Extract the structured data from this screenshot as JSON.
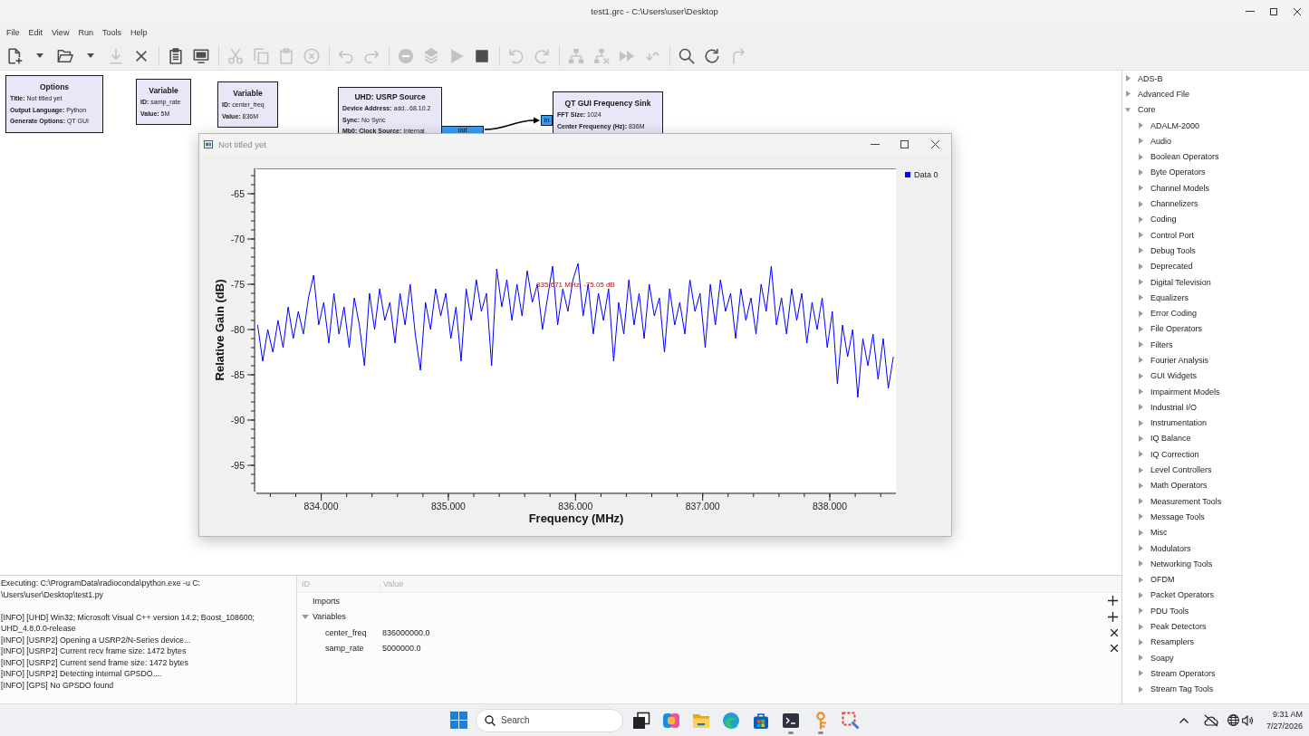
{
  "window": {
    "title": "test1.grc - C:\\Users\\user\\Desktop"
  },
  "menu": [
    "File",
    "Edit",
    "View",
    "Run",
    "Tools",
    "Help"
  ],
  "toolbar": {
    "groups": [
      [
        {
          "disabled": false
        },
        {
          "disabled": false
        },
        {
          "disabled": false
        },
        {
          "disabled": false
        },
        {
          "disabled": true
        },
        {
          "disabled": false
        }
      ],
      [
        {
          "disabled": false
        },
        {
          "disabled": false
        }
      ],
      [
        {
          "disabled": true
        },
        {
          "disabled": true
        },
        {
          "disabled": true
        },
        {
          "disabled": true
        }
      ],
      [
        {
          "disabled": true
        },
        {
          "disabled": true
        }
      ],
      [
        {
          "disabled": true
        },
        {
          "disabled": true
        },
        {
          "disabled": true
        },
        {
          "disabled": false
        }
      ],
      [
        {
          "disabled": true
        },
        {
          "disabled": true
        }
      ],
      [
        {
          "disabled": true
        },
        {
          "disabled": true
        },
        {
          "disabled": true
        },
        {
          "disabled": true
        }
      ],
      [
        {
          "disabled": false
        },
        {
          "disabled": false
        },
        {
          "disabled": true
        }
      ]
    ]
  },
  "canvas": {
    "blocks": [
      {
        "title": "Options",
        "params": [
          {
            "key": "Title:",
            "value": "Not titled yet"
          },
          {
            "key": "Output Language:",
            "value": "Python"
          },
          {
            "key": "Generate Options:",
            "value": "QT GUI"
          }
        ]
      },
      {
        "title": "Variable",
        "params": [
          {
            "key": "ID:",
            "value": "samp_rate"
          },
          {
            "key": "Value:",
            "value": "5M"
          }
        ]
      },
      {
        "title": "Variable",
        "params": [
          {
            "key": "ID:",
            "value": "center_freq"
          },
          {
            "key": "Value:",
            "value": "836M"
          }
        ]
      },
      {
        "title": "UHD: USRP Source",
        "params": [
          {
            "key": "Device Address:",
            "value": "add...68.10.2"
          },
          {
            "key": "Sync:",
            "value": "No Sync"
          },
          {
            "key": "Mb0: Clock Source:",
            "value": "Internal"
          }
        ],
        "ports": [
          {
            "kind": "out",
            "label": "out"
          }
        ]
      },
      {
        "title": "QT GUI Frequency Sink",
        "params": [
          {
            "key": "FFT Size:",
            "value": "1024"
          },
          {
            "key": "Center Frequency (Hz):",
            "value": "836M"
          }
        ],
        "ports": [
          {
            "kind": "in",
            "label": "in"
          }
        ]
      }
    ]
  },
  "plot_window": {
    "title": "Not titled yet",
    "chart_data": {
      "type": "line",
      "xlabel": "Frequency (MHz)",
      "ylabel": "Relative Gain (dB)",
      "x": [
        833.5,
        833.54,
        833.58,
        833.62,
        833.66,
        833.7,
        833.74,
        833.78,
        833.82,
        833.86,
        833.9,
        833.94,
        833.98,
        834.02,
        834.06,
        834.1,
        834.14,
        834.18,
        834.22,
        834.26,
        834.3,
        834.34,
        834.38,
        834.42,
        834.46,
        834.5,
        834.54,
        834.58,
        834.62,
        834.66,
        834.7,
        834.74,
        834.78,
        834.82,
        834.86,
        834.9,
        834.94,
        834.98,
        835.02,
        835.06,
        835.1,
        835.14,
        835.18,
        835.22,
        835.26,
        835.3,
        835.34,
        835.38,
        835.42,
        835.46,
        835.5,
        835.54,
        835.58,
        835.62,
        835.66,
        835.7,
        835.74,
        835.78,
        835.82,
        835.86,
        835.9,
        835.94,
        835.98,
        836.02,
        836.06,
        836.1,
        836.14,
        836.18,
        836.22,
        836.26,
        836.3,
        836.34,
        836.38,
        836.42,
        836.46,
        836.5,
        836.54,
        836.58,
        836.62,
        836.66,
        836.7,
        836.74,
        836.78,
        836.82,
        836.86,
        836.9,
        836.94,
        836.98,
        837.02,
        837.06,
        837.1,
        837.14,
        837.18,
        837.22,
        837.26,
        837.3,
        837.34,
        837.38,
        837.42,
        837.46,
        837.5,
        837.54,
        837.58,
        837.62,
        837.66,
        837.7,
        837.74,
        837.78,
        837.82,
        837.86,
        837.9,
        837.94,
        837.98,
        838.02,
        838.06,
        838.1,
        838.14,
        838.18,
        838.22,
        838.26,
        838.3,
        838.34,
        838.38,
        838.42,
        838.46,
        838.5
      ],
      "series": [
        {
          "name": "Data 0",
          "color": "#0000ff",
          "values": [
            -79.5,
            -83.5,
            -80,
            -82.5,
            -79,
            -82,
            -77.5,
            -81,
            -78,
            -80.5,
            -76.5,
            -74,
            -79.5,
            -77,
            -81.5,
            -76,
            -80.5,
            -77.5,
            -82,
            -76.5,
            -79.5,
            -84,
            -76,
            -80,
            -75.5,
            -79,
            -77,
            -81.5,
            -76,
            -79.5,
            -75,
            -80.5,
            -84.5,
            -77,
            -80,
            -75.5,
            -78.5,
            -76,
            -81,
            -77.5,
            -83.5,
            -75.5,
            -79,
            -74.5,
            -78,
            -76,
            -84,
            -73.3,
            -77.5,
            -74.5,
            -79,
            -75,
            -78.5,
            -73.5,
            -77,
            -75,
            -80,
            -76.5,
            -73,
            -79.5,
            -75.5,
            -78,
            -74.5,
            -72.7,
            -78.5,
            -75,
            -80.5,
            -76,
            -79,
            -75.5,
            -83.5,
            -77,
            -80.5,
            -74.5,
            -79.5,
            -76,
            -81,
            -75,
            -78.5,
            -76.5,
            -82.5,
            -75.5,
            -79.5,
            -77,
            -80.5,
            -74.5,
            -78,
            -76,
            -82,
            -75,
            -79.5,
            -74.5,
            -78,
            -76,
            -81,
            -75.5,
            -79,
            -76.5,
            -80.5,
            -75,
            -78,
            -73,
            -79.5,
            -76.5,
            -80.5,
            -75.5,
            -79,
            -76,
            -81.5,
            -77,
            -80,
            -76.5,
            -82,
            -78,
            -86,
            -79.5,
            -83,
            -80,
            -87.5,
            -81,
            -84,
            -80.5,
            -85.5,
            -81,
            -86.5,
            -83
          ]
        }
      ],
      "xlim": [
        833.49,
        838.52
      ],
      "ylim": [
        -97.9,
        -62.2
      ],
      "xticks": [
        {
          "value": 834,
          "label": "834.000"
        },
        {
          "value": 835,
          "label": "835.000"
        },
        {
          "value": 836,
          "label": "836.000"
        },
        {
          "value": 837,
          "label": "837.000"
        },
        {
          "value": 838,
          "label": "838.000"
        }
      ],
      "yticks": [
        -95,
        -90,
        -85,
        -80,
        -75,
        -70,
        -65
      ],
      "annotations": [
        {
          "text": "835.671 MHz, -75.05 dB",
          "x": 835.671,
          "y": -75.05
        }
      ]
    }
  },
  "console": {
    "entries": [
      {
        "kind": "command",
        "lines": [
          "Executing: C:\\ProgramData\\radioconda\\python.exe -u C:",
          "\\Users\\user\\Desktop\\test1.py"
        ]
      },
      {
        "kind": "log",
        "lines": [
          "[INFO] [UHD] Win32; Microsoft Visual C++ version 14.2; Boost_108600;",
          "UHD_4.8.0.0-release"
        ]
      },
      {
        "kind": "log",
        "lines": [
          "[INFO] [USRP2] Opening a USRP2/N-Series device..."
        ]
      },
      {
        "kind": "log",
        "lines": [
          "[INFO] [USRP2] Current recv frame size: 1472 bytes"
        ]
      },
      {
        "kind": "log",
        "lines": [
          "[INFO] [USRP2] Current send frame size: 1472 bytes"
        ]
      },
      {
        "kind": "log",
        "lines": [
          "[INFO] [USRP2] Detecting internal GPSDO...."
        ]
      },
      {
        "kind": "log",
        "lines": [
          "[INFO] [GPS] No GPSDO found"
        ]
      }
    ]
  },
  "variables": {
    "columns": [
      "ID",
      "Value"
    ],
    "rows": [
      {
        "kind": "group",
        "label": "Imports"
      },
      {
        "kind": "group",
        "label": "Variables",
        "expanded": true,
        "children": [
          {
            "kind": "variable",
            "label": "center_freq",
            "value": "836000000.0"
          },
          {
            "kind": "variable",
            "label": "samp_rate",
            "value": "5000000.0"
          }
        ]
      }
    ]
  },
  "block_tree": [
    {
      "label": "ADS-B",
      "expanded": false
    },
    {
      "label": "Advanced File",
      "expanded": false
    },
    {
      "label": "Core",
      "expanded": true,
      "children": [
        {
          "label": "ADALM-2000",
          "expanded": false
        },
        {
          "label": "Audio",
          "expanded": false
        },
        {
          "label": "Boolean Operators",
          "expanded": false
        },
        {
          "label": "Byte Operators",
          "expanded": false
        },
        {
          "label": "Channel Models",
          "expanded": false
        },
        {
          "label": "Channelizers",
          "expanded": false
        },
        {
          "label": "Coding",
          "expanded": false
        },
        {
          "label": "Control Port",
          "expanded": false
        },
        {
          "label": "Debug Tools",
          "expanded": false
        },
        {
          "label": "Deprecated",
          "expanded": false
        },
        {
          "label": "Digital Television",
          "expanded": false
        },
        {
          "label": "Equalizers",
          "expanded": false
        },
        {
          "label": "Error Coding",
          "expanded": false
        },
        {
          "label": "File Operators",
          "expanded": false
        },
        {
          "label": "Filters",
          "expanded": false
        },
        {
          "label": "Fourier Analysis",
          "expanded": false
        },
        {
          "label": "GUI Widgets",
          "expanded": false
        },
        {
          "label": "Impairment Models",
          "expanded": false
        },
        {
          "label": "Industrial I/O",
          "expanded": false
        },
        {
          "label": "Instrumentation",
          "expanded": false
        },
        {
          "label": "IQ Balance",
          "expanded": false
        },
        {
          "label": "IQ Correction",
          "expanded": false
        },
        {
          "label": "Level Controllers",
          "expanded": false
        },
        {
          "label": "Math Operators",
          "expanded": false
        },
        {
          "label": "Measurement Tools",
          "expanded": false
        },
        {
          "label": "Message Tools",
          "expanded": false
        },
        {
          "label": "Misc",
          "expanded": false
        },
        {
          "label": "Modulators",
          "expanded": false
        },
        {
          "label": "Networking Tools",
          "expanded": false
        },
        {
          "label": "OFDM",
          "expanded": false
        },
        {
          "label": "Packet Operators",
          "expanded": false
        },
        {
          "label": "PDU Tools",
          "expanded": false
        },
        {
          "label": "Peak Detectors",
          "expanded": false
        },
        {
          "label": "Resamplers",
          "expanded": false
        },
        {
          "label": "Soapy",
          "expanded": false
        },
        {
          "label": "Stream Operators",
          "expanded": false
        },
        {
          "label": "Stream Tag Tools",
          "expanded": false
        }
      ]
    }
  ],
  "taskbar": {
    "search": {
      "placeholder": "Search"
    },
    "apps": [
      {
        "running": false
      },
      {
        "running": false
      },
      {
        "running": false
      },
      {
        "running": false
      },
      {
        "running": false
      },
      {
        "running": true
      },
      {
        "running": true
      },
      {
        "running": false
      }
    ],
    "clock": {
      "time": "9:31 AM",
      "date": "7/27/2026"
    }
  }
}
